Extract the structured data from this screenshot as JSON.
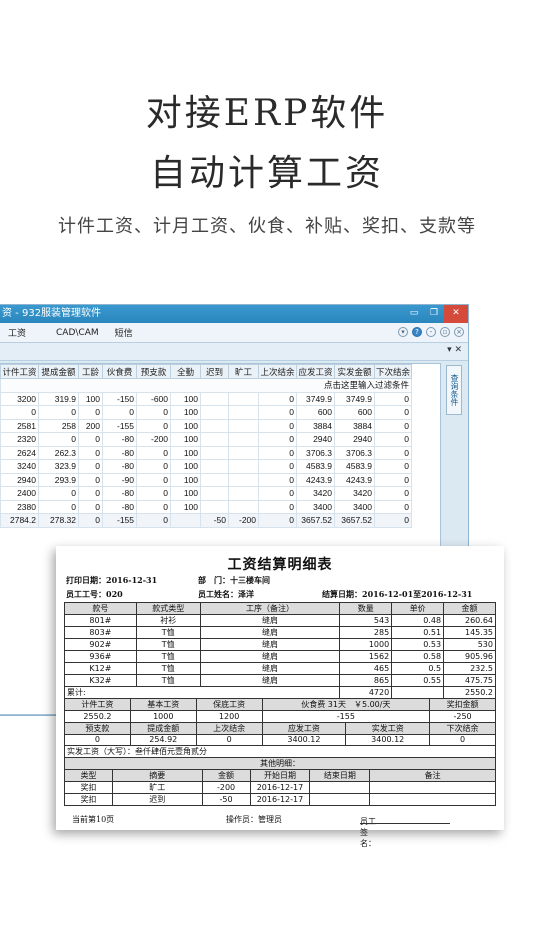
{
  "hero": {
    "line1": "对接ERP软件",
    "line2": "自动计算工资",
    "subtitle": "计件工资、计月工资、伙食、补贴、奖扣、支款等"
  },
  "window": {
    "title": "资 - 932服装管理软件",
    "controls": [
      "▭",
      "❐",
      "✕"
    ],
    "menu": [
      "工资",
      "CAD\\CAM",
      "短信"
    ],
    "side_tab": "查询条件",
    "filter_hint": "点击这里输入过滤条件",
    "columns": [
      "计件工资",
      "提成金额",
      "工龄",
      "伙食费",
      "预支款",
      "全勤",
      "迟到",
      "旷工",
      "上次结余",
      "应发工资",
      "实发金额",
      "下次结余"
    ],
    "rows": [
      [
        "3200",
        "319.9",
        "100",
        "-150",
        "-600",
        "100",
        "",
        "",
        "0",
        "3749.9",
        "3749.9",
        "0"
      ],
      [
        "0",
        "0",
        "0",
        "0",
        "0",
        "100",
        "",
        "",
        "0",
        "600",
        "600",
        "0"
      ],
      [
        "2581",
        "258",
        "200",
        "-155",
        "0",
        "100",
        "",
        "",
        "0",
        "3884",
        "3884",
        "0"
      ],
      [
        "2320",
        "0",
        "0",
        "-80",
        "-200",
        "100",
        "",
        "",
        "0",
        "2940",
        "2940",
        "0"
      ],
      [
        "2624",
        "262.3",
        "0",
        "-80",
        "0",
        "100",
        "",
        "",
        "0",
        "3706.3",
        "3706.3",
        "0"
      ],
      [
        "3240",
        "323.9",
        "0",
        "-80",
        "0",
        "100",
        "",
        "",
        "0",
        "4583.9",
        "4583.9",
        "0"
      ],
      [
        "2940",
        "293.9",
        "0",
        "-90",
        "0",
        "100",
        "",
        "",
        "0",
        "4243.9",
        "4243.9",
        "0"
      ],
      [
        "2400",
        "0",
        "0",
        "-80",
        "0",
        "100",
        "",
        "",
        "0",
        "3420",
        "3420",
        "0"
      ],
      [
        "2380",
        "0",
        "0",
        "-80",
        "0",
        "100",
        "",
        "",
        "0",
        "3400",
        "3400",
        "0"
      ]
    ],
    "sum_row": [
      "2784.2",
      "278.32",
      "0",
      "-155",
      "0",
      "",
      "-50",
      "-200",
      "0",
      "3657.52",
      "3657.52",
      "0"
    ]
  },
  "slip": {
    "title": "工资结算明细表",
    "print_date": "打印日期：2016-12-31",
    "dept": "部　门：十三楼车间",
    "emp_no": "员工工号：020",
    "emp_name": "员工姓名：泽洋",
    "period": "结算日期：2016-12-01至2016-12-31",
    "item_headers": [
      "款号",
      "款式类型",
      "工序（备注）",
      "数量",
      "单价",
      "金额"
    ],
    "items": [
      [
        "801#",
        "衬衫",
        "缝肩",
        "543",
        "0.48",
        "260.64"
      ],
      [
        "803#",
        "T恤",
        "缝肩",
        "285",
        "0.51",
        "145.35"
      ],
      [
        "902#",
        "T恤",
        "缝肩",
        "1000",
        "0.53",
        "530"
      ],
      [
        "936#",
        "T恤",
        "缝肩",
        "1562",
        "0.58",
        "905.96"
      ],
      [
        "K12#",
        "T恤",
        "缝肩",
        "465",
        "0.5",
        "232.5"
      ],
      [
        "K32#",
        "T恤",
        "缝肩",
        "865",
        "0.55",
        "475.75"
      ]
    ],
    "total_label": "累计:",
    "total_qty": "4720",
    "total_amount": "2550.2",
    "summary_headers": [
      "计件工资",
      "基本工资",
      "保底工资",
      "伙食费 31天　￥5.00/天",
      "奖扣金额"
    ],
    "summary_values": [
      "2550.2",
      "1000",
      "1200",
      "-155",
      "-250"
    ],
    "summary2_headers": [
      "预支款",
      "提成金额",
      "上次结余",
      "应发工资",
      "实发工资",
      "下次结余"
    ],
    "summary2_values": [
      "0",
      "254.92",
      "0",
      "3400.12",
      "3400.12",
      "0"
    ],
    "amount_words": "实发工资（大写）：叁仟肆佰元壹角贰分",
    "other_title": "其他明细：",
    "other_headers": [
      "类型",
      "摘要",
      "金额",
      "开始日期",
      "结束日期",
      "备注"
    ],
    "other_rows": [
      [
        "奖扣",
        "旷工",
        "-200",
        "2016-12-17",
        "",
        ""
      ],
      [
        "奖扣",
        "迟到",
        "-50",
        "2016-12-17",
        "",
        ""
      ]
    ],
    "page_label": "当前第10页",
    "operator": "操作员：管理员",
    "sign_label": "员工签名："
  }
}
